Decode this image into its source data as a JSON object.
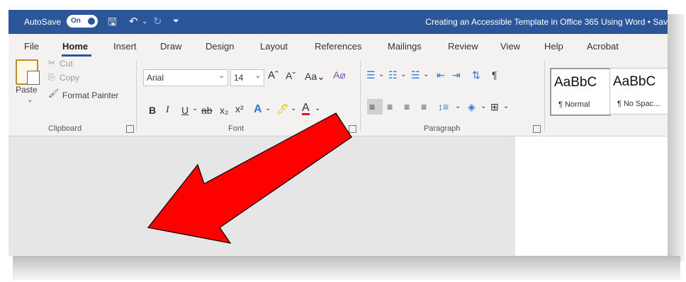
{
  "titlebar": {
    "autosave_label": "AutoSave",
    "autosave_state": "On",
    "document_title": "Creating an Accessible Template in Office 365 Using Word • Sav",
    "icons": [
      "save-icon",
      "undo-icon",
      "redo-icon",
      "customize-quick-access-icon"
    ]
  },
  "menu": {
    "tabs": [
      "File",
      "Home",
      "Insert",
      "Draw",
      "Design",
      "Layout",
      "References",
      "Mailings",
      "Review",
      "View",
      "Help",
      "Acrobat"
    ],
    "active": "Home"
  },
  "clipboard": {
    "paste": "Paste",
    "cut": "Cut",
    "copy": "Copy",
    "format_painter": "Format Painter",
    "label": "Clipboard"
  },
  "font": {
    "font_name": "Arial",
    "font_size": "14",
    "label": "Font"
  },
  "paragraph": {
    "label": "Paragraph"
  },
  "styles": {
    "items": [
      {
        "sample": "AaBbC",
        "name": "¶ Normal"
      },
      {
        "sample": "AaBbC",
        "name": "¶ No Spac..."
      }
    ]
  },
  "colors": {
    "accent": "#2b579a",
    "annotation_arrow": "#ff0000",
    "ribbon_bg": "#f3f2f1"
  }
}
